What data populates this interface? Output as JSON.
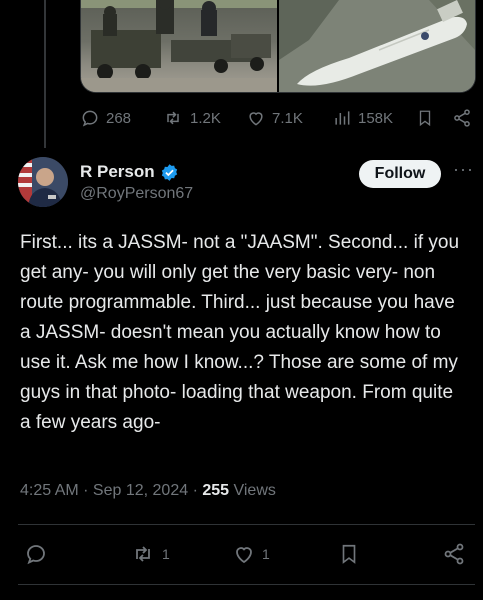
{
  "media": {
    "left_image_desc": "troops-loading-missile-photo",
    "right_image_desc": "missile-on-ground-photo"
  },
  "parent_actions": {
    "replies": "268",
    "reposts": "1.2K",
    "likes": "7.1K",
    "views": "158K"
  },
  "author": {
    "name": "R Person",
    "handle": "@RoyPerson67",
    "verified": true,
    "follow_label": "Follow",
    "more_label": "···"
  },
  "tweet": {
    "text": "First... its a JASSM- not a \"JAASM\". Second... if you get any- you will only get the very basic very- non route programmable. Third... just because you have a JASSM- doesn't mean you actually know how to use it. Ask me how I know...? Those are some of my guys in that photo- loading that weapon. From quite a few years ago-",
    "time": "4:25 AM",
    "sep1": " · ",
    "date": "Sep 12, 2024",
    "sep2": " · ",
    "views_count": "255",
    "views_label": " Views"
  },
  "bottom_actions": {
    "reposts": "1",
    "likes": "1"
  },
  "colors": {
    "background": "#000000",
    "text": "#e7e9ea",
    "secondary": "#71767b",
    "verified": "#1d9bf0"
  }
}
